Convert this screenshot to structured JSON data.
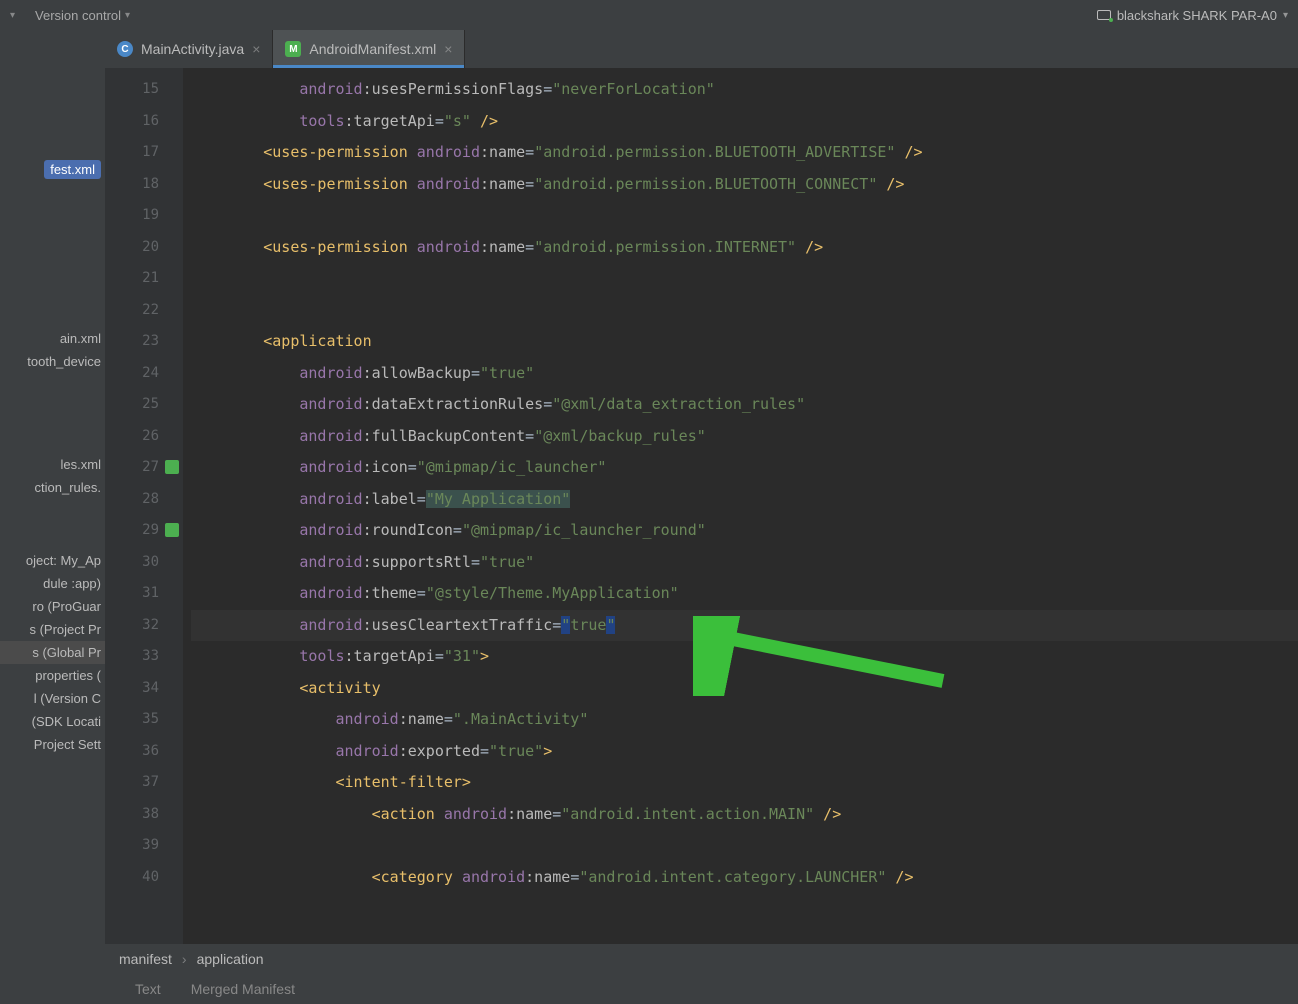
{
  "topbar": {
    "left_item1": "",
    "version_control": "Version control",
    "device_name": "blackshark SHARK PAR-A0"
  },
  "sidebar": {
    "selected": "fest.xml",
    "items": [
      "ain.xml",
      "tooth_device"
    ],
    "items2": [
      "les.xml",
      "ction_rules."
    ],
    "items3": [
      "oject: My_Ap",
      "dule :app)",
      "ro (ProGuar",
      "s (Project Pr",
      "s (Global Pr",
      "properties (",
      "l (Version C",
      "(SDK Locati",
      "Project Sett"
    ],
    "items3_selected_idx": 4
  },
  "tabs": [
    {
      "icon": "C",
      "label": "MainActivity.java",
      "active": false
    },
    {
      "icon": "M",
      "label": "AndroidManifest.xml",
      "active": true
    }
  ],
  "gutter": {
    "start": 15,
    "end": 40,
    "icon_lines": [
      27,
      29
    ]
  },
  "code_lines": [
    {
      "n": 15,
      "indent": 3,
      "parts": [
        {
          "t": "ns",
          "v": "android"
        },
        {
          "t": "a",
          "v": ":usesPermissionFlags"
        },
        {
          "t": "eq",
          "v": "="
        },
        {
          "t": "s",
          "v": "\"neverForLocation\""
        }
      ]
    },
    {
      "n": 16,
      "indent": 3,
      "parts": [
        {
          "t": "ns",
          "v": "tools"
        },
        {
          "t": "a",
          "v": ":targetApi"
        },
        {
          "t": "eq",
          "v": "="
        },
        {
          "t": "s",
          "v": "\"s\""
        },
        {
          "t": "tag",
          "v": " />"
        }
      ]
    },
    {
      "n": 17,
      "indent": 2,
      "parts": [
        {
          "t": "tag",
          "v": "<uses-permission "
        },
        {
          "t": "ns",
          "v": "android"
        },
        {
          "t": "a",
          "v": ":name"
        },
        {
          "t": "eq",
          "v": "="
        },
        {
          "t": "s",
          "v": "\"android.permission.BLUETOOTH_ADVERTISE\""
        },
        {
          "t": "tag",
          "v": " />"
        }
      ]
    },
    {
      "n": 18,
      "indent": 2,
      "parts": [
        {
          "t": "tag",
          "v": "<uses-permission "
        },
        {
          "t": "ns",
          "v": "android"
        },
        {
          "t": "a",
          "v": ":name"
        },
        {
          "t": "eq",
          "v": "="
        },
        {
          "t": "s",
          "v": "\"android.permission.BLUETOOTH_CONNECT\""
        },
        {
          "t": "tag",
          "v": " />"
        }
      ]
    },
    {
      "n": 19,
      "indent": 0,
      "parts": []
    },
    {
      "n": 20,
      "indent": 2,
      "parts": [
        {
          "t": "tag",
          "v": "<uses-permission "
        },
        {
          "t": "ns",
          "v": "android"
        },
        {
          "t": "a",
          "v": ":name"
        },
        {
          "t": "eq",
          "v": "="
        },
        {
          "t": "s",
          "v": "\"android.permission.INTERNET\""
        },
        {
          "t": "tag",
          "v": " />"
        }
      ]
    },
    {
      "n": 21,
      "indent": 0,
      "parts": []
    },
    {
      "n": 22,
      "indent": 0,
      "parts": []
    },
    {
      "n": 23,
      "indent": 2,
      "parts": [
        {
          "t": "tag",
          "v": "<application"
        }
      ]
    },
    {
      "n": 24,
      "indent": 3,
      "parts": [
        {
          "t": "ns",
          "v": "android"
        },
        {
          "t": "a",
          "v": ":allowBackup"
        },
        {
          "t": "eq",
          "v": "="
        },
        {
          "t": "s",
          "v": "\"true\""
        }
      ]
    },
    {
      "n": 25,
      "indent": 3,
      "parts": [
        {
          "t": "ns",
          "v": "android"
        },
        {
          "t": "a",
          "v": ":dataExtractionRules"
        },
        {
          "t": "eq",
          "v": "="
        },
        {
          "t": "s",
          "v": "\"@xml/data_extraction_rules\""
        }
      ]
    },
    {
      "n": 26,
      "indent": 3,
      "parts": [
        {
          "t": "ns",
          "v": "android"
        },
        {
          "t": "a",
          "v": ":fullBackupContent"
        },
        {
          "t": "eq",
          "v": "="
        },
        {
          "t": "s",
          "v": "\"@xml/backup_rules\""
        }
      ]
    },
    {
      "n": 27,
      "indent": 3,
      "parts": [
        {
          "t": "ns",
          "v": "android"
        },
        {
          "t": "a",
          "v": ":icon"
        },
        {
          "t": "eq",
          "v": "="
        },
        {
          "t": "s",
          "v": "\"@mipmap/ic_launcher\""
        }
      ]
    },
    {
      "n": 28,
      "indent": 3,
      "parts": [
        {
          "t": "ns",
          "v": "android"
        },
        {
          "t": "a",
          "v": ":label"
        },
        {
          "t": "eq",
          "v": "="
        },
        {
          "t": "sh",
          "v": "\"My Application\""
        }
      ]
    },
    {
      "n": 29,
      "indent": 3,
      "parts": [
        {
          "t": "ns",
          "v": "android"
        },
        {
          "t": "a",
          "v": ":roundIcon"
        },
        {
          "t": "eq",
          "v": "="
        },
        {
          "t": "s",
          "v": "\"@mipmap/ic_launcher_round\""
        }
      ]
    },
    {
      "n": 30,
      "indent": 3,
      "parts": [
        {
          "t": "ns",
          "v": "android"
        },
        {
          "t": "a",
          "v": ":supportsRtl"
        },
        {
          "t": "eq",
          "v": "="
        },
        {
          "t": "s",
          "v": "\"true\""
        }
      ]
    },
    {
      "n": 31,
      "indent": 3,
      "parts": [
        {
          "t": "ns",
          "v": "android"
        },
        {
          "t": "a",
          "v": ":theme"
        },
        {
          "t": "eq",
          "v": "="
        },
        {
          "t": "s",
          "v": "\"@style/Theme.MyApplication\""
        }
      ]
    },
    {
      "n": 32,
      "indent": 3,
      "hl": true,
      "parts": [
        {
          "t": "ns",
          "v": "android"
        },
        {
          "t": "a",
          "v": ":usesCleartextTraffic"
        },
        {
          "t": "eq",
          "v": "="
        },
        {
          "t": "qh",
          "v": "\""
        },
        {
          "t": "s",
          "v": "true"
        },
        {
          "t": "qh",
          "v": "\""
        }
      ]
    },
    {
      "n": 33,
      "indent": 3,
      "parts": [
        {
          "t": "ns",
          "v": "tools"
        },
        {
          "t": "a",
          "v": ":targetApi"
        },
        {
          "t": "eq",
          "v": "="
        },
        {
          "t": "s",
          "v": "\"31\""
        },
        {
          "t": "tag",
          "v": ">"
        }
      ]
    },
    {
      "n": 34,
      "indent": 3,
      "parts": [
        {
          "t": "tag",
          "v": "<activity"
        }
      ]
    },
    {
      "n": 35,
      "indent": 4,
      "parts": [
        {
          "t": "ns",
          "v": "android"
        },
        {
          "t": "a",
          "v": ":name"
        },
        {
          "t": "eq",
          "v": "="
        },
        {
          "t": "s",
          "v": "\".MainActivity\""
        }
      ]
    },
    {
      "n": 36,
      "indent": 4,
      "parts": [
        {
          "t": "ns",
          "v": "android"
        },
        {
          "t": "a",
          "v": ":exported"
        },
        {
          "t": "eq",
          "v": "="
        },
        {
          "t": "s",
          "v": "\"true\""
        },
        {
          "t": "tag",
          "v": ">"
        }
      ]
    },
    {
      "n": 37,
      "indent": 4,
      "parts": [
        {
          "t": "tag",
          "v": "<intent-filter>"
        }
      ]
    },
    {
      "n": 38,
      "indent": 5,
      "parts": [
        {
          "t": "tag",
          "v": "<action "
        },
        {
          "t": "ns",
          "v": "android"
        },
        {
          "t": "a",
          "v": ":name"
        },
        {
          "t": "eq",
          "v": "="
        },
        {
          "t": "s",
          "v": "\"android.intent.action.MAIN\""
        },
        {
          "t": "tag",
          "v": " />"
        }
      ]
    },
    {
      "n": 39,
      "indent": 0,
      "parts": []
    },
    {
      "n": 40,
      "indent": 5,
      "parts": [
        {
          "t": "tag",
          "v": "<category "
        },
        {
          "t": "ns",
          "v": "android"
        },
        {
          "t": "a",
          "v": ":name"
        },
        {
          "t": "eq",
          "v": "="
        },
        {
          "t": "s",
          "v": "\"android.intent.category.LAUNCHER\""
        },
        {
          "t": "tag",
          "v": " />"
        }
      ]
    }
  ],
  "breadcrumb": [
    "manifest",
    "application"
  ],
  "bottom_tabs": [
    "Text",
    "Merged Manifest"
  ]
}
